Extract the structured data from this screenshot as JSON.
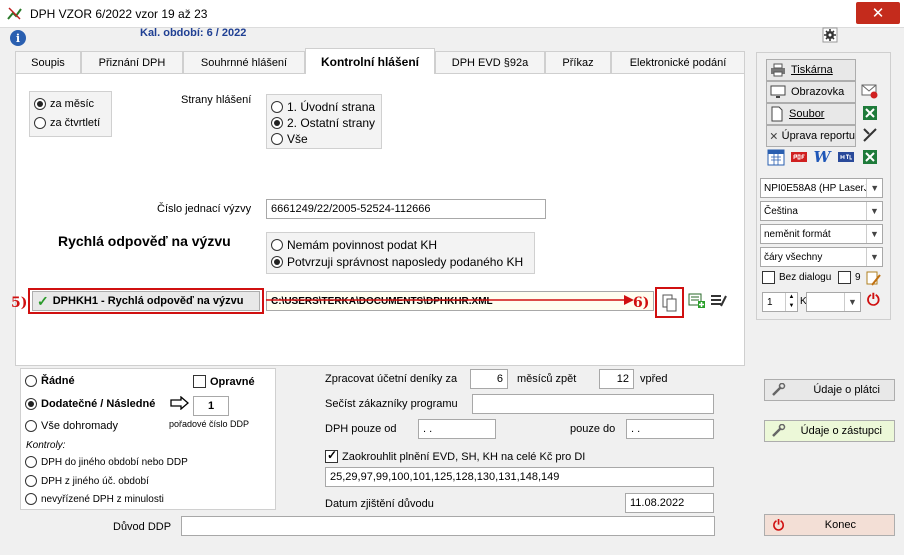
{
  "window": {
    "title": "DPH VZOR  6/2022 vzor 19 až 23",
    "close": "✕"
  },
  "header": {
    "period": "Kal. období: 6 / 2022"
  },
  "tabs": [
    {
      "label": "Soupis"
    },
    {
      "label": "Přiznání DPH"
    },
    {
      "label": "Souhrnné hlášení"
    },
    {
      "label": "Kontrolní hlášení"
    },
    {
      "label": "DPH EVD §92a"
    },
    {
      "label": "Příkaz"
    },
    {
      "label": "Elektronické podání"
    }
  ],
  "period_group": {
    "monthly": "za měsíc",
    "quarterly": "za čtvrtletí"
  },
  "pages_group": {
    "label": "Strany hlášení",
    "options": [
      "1. Úvodní strana",
      "2. Ostatní strany",
      "Vše"
    ]
  },
  "reference": {
    "label": "Číslo jednací výzvy",
    "value": "6661249/22/2005-52524-112666"
  },
  "quick_answer": {
    "heading": "Rychlá odpověď na výzvu",
    "options": [
      "Nemám povinnost podat KH",
      "Potvrzuji správnost naposledy podaného KH"
    ],
    "step5": "5)",
    "file_button": "DPHKH1 - Rychlá odpověď na výzvu",
    "path": "C:\\USERS\\TERKA\\DOCUMENTS\\DPHKHR.XML",
    "step6": "6)"
  },
  "filing_type": {
    "regular": "Řádné",
    "corrective": "Opravné",
    "supplementary": "Dodatečné / Následné",
    "all": "Vše dohromady",
    "ddp_number": "1",
    "ddp_label": "pořadové číslo DDP",
    "controls_label": "Kontroly:",
    "controls": [
      "DPH do jiného období nebo DDP",
      "DPH z jiného úč. období",
      "nevyřízené DPH z minulosti"
    ]
  },
  "processing": {
    "diary_label": "Zpracovat účetní deníky za",
    "months_back": "6",
    "months_back_label": "měsíců zpět",
    "months_fwd": "12",
    "months_fwd_label": "vpřed",
    "customers_label": "Sečíst zákazníky programu",
    "customers_value": "",
    "vat_from_label": "DPH pouze od",
    "vat_from": " .  .",
    "vat_to_label": "pouze do",
    "vat_to": " .  .",
    "round_label": "Zaokrouhlit plnění EVD, SH, KH na celé Kč pro DI",
    "round_values": "25,29,97,99,100,101,125,128,130,131,148,149",
    "date_label": "Datum zjištění důvodu",
    "date": "11.08.2022",
    "reason_label": "Důvod DDP",
    "reason_value": ""
  },
  "side": {
    "print": "Tiskárna",
    "screen": "Obrazovka",
    "file": "Soubor",
    "report_edit": "Úprava reportu",
    "printer": "NPI0E58A8 (HP LaserJ",
    "language": "Čeština",
    "format": "neměnit formát",
    "lines": "čáry všechny",
    "no_dialog": "Bez dialogu",
    "size": "9",
    "copies": "1",
    "k_label": "K"
  },
  "actions": {
    "payer": "Údaje o plátci",
    "representative": "Údaje o zástupci",
    "end": "Konec"
  }
}
